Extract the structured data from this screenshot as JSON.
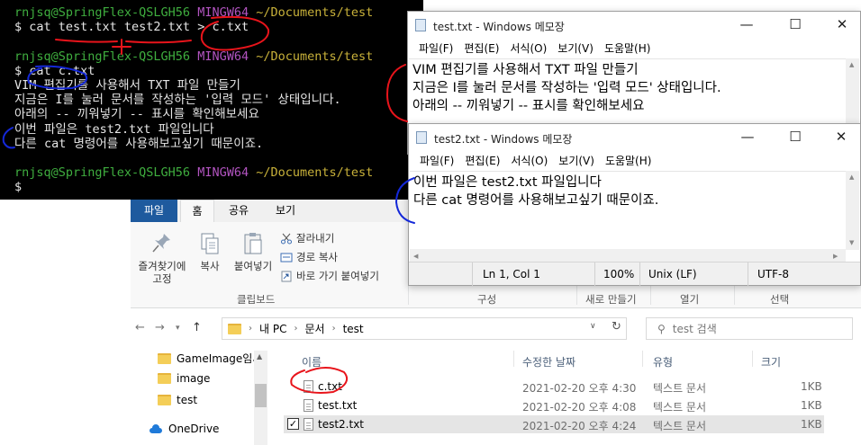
{
  "terminal": {
    "prompt1": {
      "user": "rnjsq@SpringFlex-QSLGH56",
      "sys": "MINGW64",
      "path": "~/Documents/test"
    },
    "cmd1": "$ cat test.txt test2.txt > c.txt",
    "prompt2": {
      "user": "rnjsq@SpringFlex-QSLGH56",
      "sys": "MINGW64",
      "path": "~/Documents/test"
    },
    "cmd2": "$ cat c.txt",
    "output": [
      "VIM 편집기를 사용해서 TXT 파일 만들기",
      "지금은 I를 눌러 문서를 작성하는 '입력 모드' 상태입니다.",
      "아래의 -- 끼워넣기 -- 표시를 확인해보세요",
      "이번 파일은 test2.txt 파일입니다",
      "다른 cat 명령어를 사용해보고싶기 때문이죠."
    ],
    "prompt3": {
      "user": "rnjsq@SpringFlex-QSLGH56",
      "sys": "MINGW64",
      "path": "~/Documents/test"
    },
    "cmd3": "$"
  },
  "notepad1": {
    "title": "test.txt - Windows 메모장",
    "menu": [
      "파일(F)",
      "편집(E)",
      "서식(O)",
      "보기(V)",
      "도움말(H)"
    ],
    "lines": [
      "VIM 편집기를 사용해서 TXT 파일 만들기",
      "지금은 I를 눌러 문서를 작성하는 '입력 모드' 상태입니다.",
      "아래의 -- 끼워넣기 -- 표시를 확인해보세요"
    ]
  },
  "notepad2": {
    "title": "test2.txt - Windows 메모장",
    "menu": [
      "파일(F)",
      "편집(E)",
      "서식(O)",
      "보기(V)",
      "도움말(H)"
    ],
    "lines": [
      "이번 파일은 test2.txt 파일입니다",
      "다른 cat 명령어를 사용해보고싶기 때문이죠."
    ],
    "status": {
      "position": "Ln 1, Col 1",
      "zoom": "100%",
      "eol": "Unix (LF)",
      "encoding": "UTF-8"
    }
  },
  "explorer": {
    "tabs": [
      "파일",
      "홈",
      "공유",
      "보기"
    ],
    "ribbon": {
      "pin_label_1": "즐겨찾기에",
      "pin_label_2": "고정",
      "copy": "복사",
      "paste": "붙여넣기",
      "cut": "잘라내기",
      "copy_path": "경로 복사",
      "paste_shortcut": "바로 가기 붙여넣기",
      "group_clipboard": "클립보드",
      "group_organize": "구성",
      "group_new": "새로 만들기",
      "group_open": "열기",
      "group_select": "선택"
    },
    "breadcrumb": [
      "내 PC",
      "문서",
      "test"
    ],
    "search_placeholder": "test 검색",
    "nav_items": [
      "GameImage임시",
      "image",
      "test",
      "OneDrive"
    ],
    "columns": {
      "name": "이름",
      "date": "수정한 날짜",
      "type": "유형",
      "size": "크기"
    },
    "files": [
      {
        "name": "c.txt",
        "date": "2021-02-20 오후 4:30",
        "type": "텍스트 문서",
        "size": "1KB"
      },
      {
        "name": "test.txt",
        "date": "2021-02-20 오후 4:08",
        "type": "텍스트 문서",
        "size": "1KB"
      },
      {
        "name": "test2.txt",
        "date": "2021-02-20 오후 4:24",
        "type": "텍스트 문서",
        "size": "1KB"
      }
    ]
  },
  "colors": {
    "terminal_bg": "#000000",
    "prompt_user": "#3fae3f",
    "prompt_sys": "#b254c0",
    "prompt_path": "#c9b23a",
    "file_tab": "#1e5a9e",
    "annotation_red": "#e8141b",
    "annotation_blue": "#1428d8"
  }
}
